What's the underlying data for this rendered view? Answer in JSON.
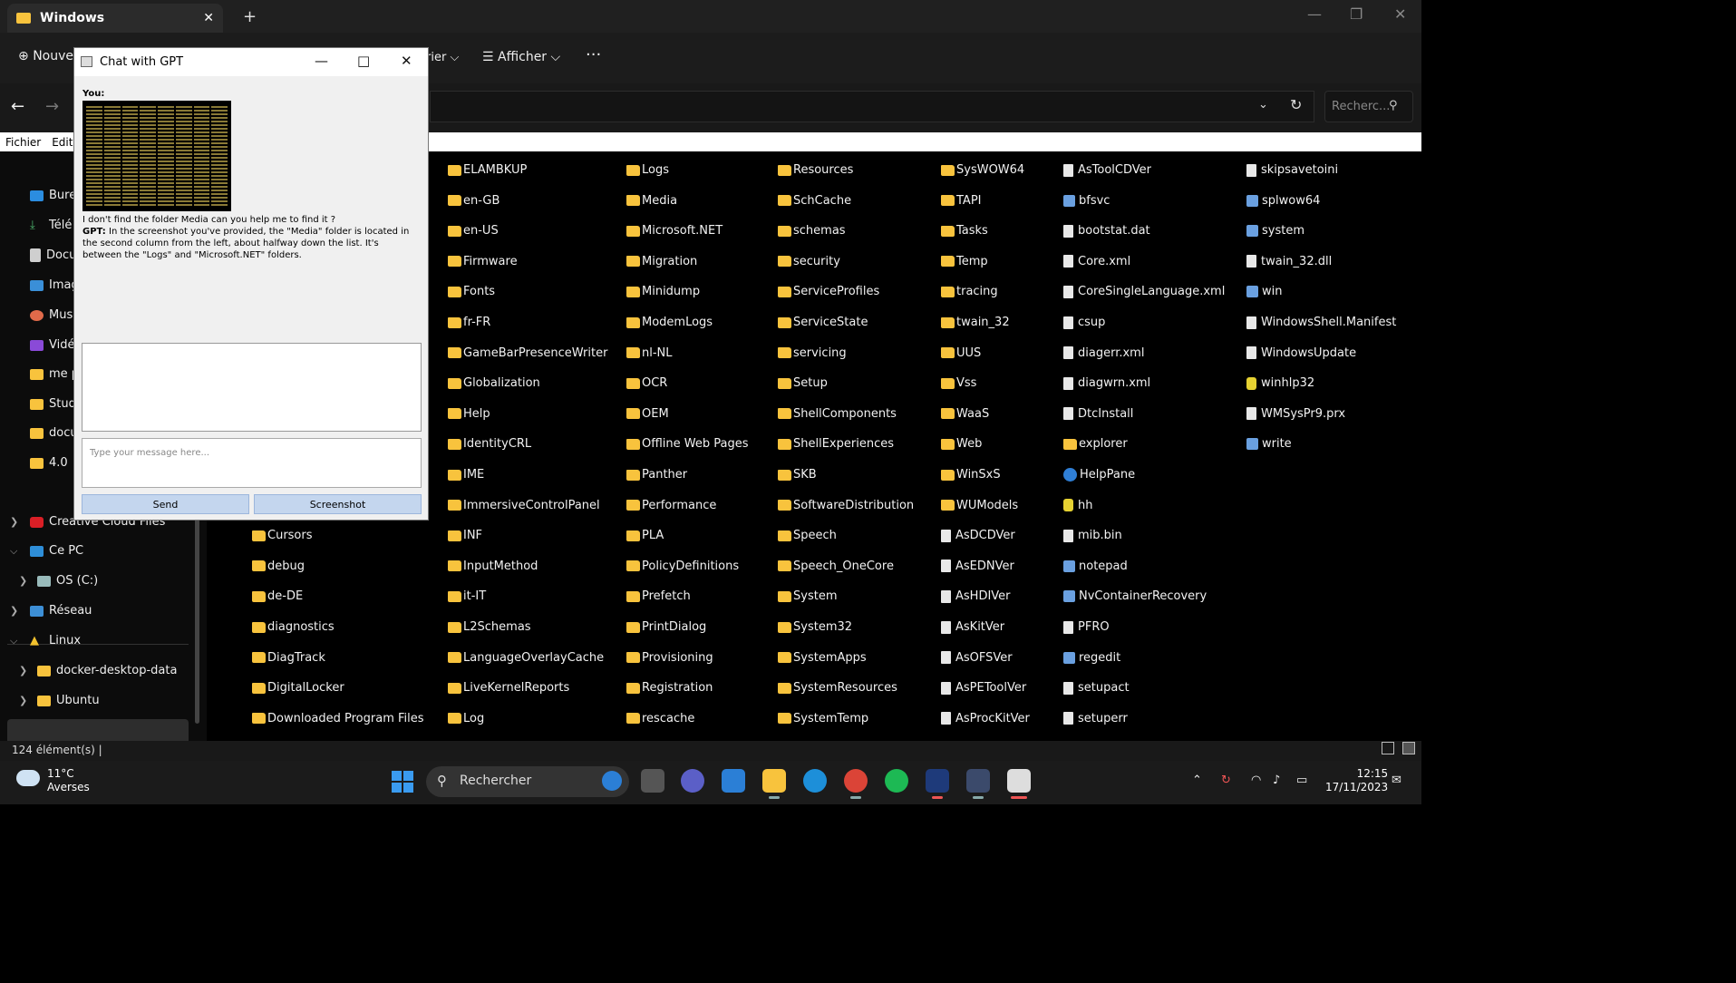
{
  "explorer": {
    "tab_title": "Windows",
    "close_tab": "✕",
    "new_tab": "+",
    "toolbar": {
      "new_label": "Nouve",
      "sort_label": "rier",
      "view_label": "Afficher",
      "more_label": "···"
    },
    "search_placeholder": "Recherc...",
    "menu": [
      "Fichier",
      "Editi"
    ],
    "status": "124 élément(s)   |",
    "sidebar": {
      "items": [
        "Bure",
        "Télé",
        "Docu",
        "Imag",
        "Musi",
        "Vidé",
        "me p",
        "Stud",
        "docu",
        "4.0"
      ],
      "creative_cloud": "Creative Cloud Files",
      "this_pc": "Ce PC",
      "os_c": "OS (C:)",
      "network": "Réseau",
      "linux": "Linux",
      "docker": "docker-desktop-data",
      "ubuntu": "Ubuntu"
    },
    "columns": [
      {
        "top_offset": 0,
        "items": [
          {
            "n": "Cursors",
            "t": "folder"
          },
          {
            "n": "debug",
            "t": "folder"
          },
          {
            "n": "de-DE",
            "t": "folder"
          },
          {
            "n": "diagnostics",
            "t": "folder"
          },
          {
            "n": "DiagTrack",
            "t": "folder"
          },
          {
            "n": "DigitalLocker",
            "t": "folder"
          },
          {
            "n": "Downloaded Program Files",
            "t": "folder"
          }
        ]
      },
      {
        "items": [
          {
            "n": "ELAMBKUP",
            "t": "folder"
          },
          {
            "n": "en-GB",
            "t": "folder"
          },
          {
            "n": "en-US",
            "t": "folder"
          },
          {
            "n": "Firmware",
            "t": "folder"
          },
          {
            "n": "Fonts",
            "t": "folder"
          },
          {
            "n": "fr-FR",
            "t": "folder"
          },
          {
            "n": "GameBarPresenceWriter",
            "t": "folder"
          },
          {
            "n": "Globalization",
            "t": "folder"
          },
          {
            "n": "Help",
            "t": "folder"
          },
          {
            "n": "IdentityCRL",
            "t": "folder"
          },
          {
            "n": "IME",
            "t": "folder"
          },
          {
            "n": "ImmersiveControlPanel",
            "t": "folder"
          },
          {
            "n": "INF",
            "t": "folder"
          },
          {
            "n": "InputMethod",
            "t": "folder"
          },
          {
            "n": "it-IT",
            "t": "folder"
          },
          {
            "n": "L2Schemas",
            "t": "folder"
          },
          {
            "n": "LanguageOverlayCache",
            "t": "folder"
          },
          {
            "n": "LiveKernelReports",
            "t": "folder"
          },
          {
            "n": "Log",
            "t": "folder"
          }
        ]
      },
      {
        "items": [
          {
            "n": "Logs",
            "t": "folder"
          },
          {
            "n": "Media",
            "t": "folder"
          },
          {
            "n": "Microsoft.NET",
            "t": "folder"
          },
          {
            "n": "Migration",
            "t": "folder"
          },
          {
            "n": "Minidump",
            "t": "folder"
          },
          {
            "n": "ModemLogs",
            "t": "folder"
          },
          {
            "n": "nl-NL",
            "t": "folder"
          },
          {
            "n": "OCR",
            "t": "folder"
          },
          {
            "n": "OEM",
            "t": "folder"
          },
          {
            "n": "Offline Web Pages",
            "t": "folder"
          },
          {
            "n": "Panther",
            "t": "folder"
          },
          {
            "n": "Performance",
            "t": "folder"
          },
          {
            "n": "PLA",
            "t": "folder"
          },
          {
            "n": "PolicyDefinitions",
            "t": "folder"
          },
          {
            "n": "Prefetch",
            "t": "folder"
          },
          {
            "n": "PrintDialog",
            "t": "folder"
          },
          {
            "n": "Provisioning",
            "t": "folder"
          },
          {
            "n": "Registration",
            "t": "folder"
          },
          {
            "n": "rescache",
            "t": "folder"
          }
        ]
      },
      {
        "items": [
          {
            "n": "Resources",
            "t": "folder"
          },
          {
            "n": "SchCache",
            "t": "folder"
          },
          {
            "n": "schemas",
            "t": "folder"
          },
          {
            "n": "security",
            "t": "folder"
          },
          {
            "n": "ServiceProfiles",
            "t": "folder"
          },
          {
            "n": "ServiceState",
            "t": "folder"
          },
          {
            "n": "servicing",
            "t": "folder"
          },
          {
            "n": "Setup",
            "t": "folder"
          },
          {
            "n": "ShellComponents",
            "t": "folder"
          },
          {
            "n": "ShellExperiences",
            "t": "folder"
          },
          {
            "n": "SKB",
            "t": "folder"
          },
          {
            "n": "SoftwareDistribution",
            "t": "folder"
          },
          {
            "n": "Speech",
            "t": "folder"
          },
          {
            "n": "Speech_OneCore",
            "t": "folder"
          },
          {
            "n": "System",
            "t": "folder"
          },
          {
            "n": "System32",
            "t": "folder"
          },
          {
            "n": "SystemApps",
            "t": "folder"
          },
          {
            "n": "SystemResources",
            "t": "folder"
          },
          {
            "n": "SystemTemp",
            "t": "folder"
          }
        ]
      },
      {
        "items": [
          {
            "n": "SysWOW64",
            "t": "folder"
          },
          {
            "n": "TAPI",
            "t": "folder"
          },
          {
            "n": "Tasks",
            "t": "folder"
          },
          {
            "n": "Temp",
            "t": "folder"
          },
          {
            "n": "tracing",
            "t": "folder"
          },
          {
            "n": "twain_32",
            "t": "folder"
          },
          {
            "n": "UUS",
            "t": "folder"
          },
          {
            "n": "Vss",
            "t": "folder"
          },
          {
            "n": "WaaS",
            "t": "folder"
          },
          {
            "n": "Web",
            "t": "folder"
          },
          {
            "n": "WinSxS",
            "t": "folder"
          },
          {
            "n": "WUModels",
            "t": "folder"
          },
          {
            "n": "AsDCDVer",
            "t": "file"
          },
          {
            "n": "AsEDNVer",
            "t": "file"
          },
          {
            "n": "AsHDIVer",
            "t": "file"
          },
          {
            "n": "AsKitVer",
            "t": "file"
          },
          {
            "n": "AsOFSVer",
            "t": "file"
          },
          {
            "n": "AsPEToolVer",
            "t": "file"
          },
          {
            "n": "AsProcKitVer",
            "t": "file"
          }
        ]
      },
      {
        "items": [
          {
            "n": "AsToolCDVer",
            "t": "file"
          },
          {
            "n": "bfsvc",
            "t": "app"
          },
          {
            "n": "bootstat.dat",
            "t": "file"
          },
          {
            "n": "Core.xml",
            "t": "file"
          },
          {
            "n": "CoreSingleLanguage.xml",
            "t": "file"
          },
          {
            "n": "csup",
            "t": "file"
          },
          {
            "n": "diagerr.xml",
            "t": "file"
          },
          {
            "n": "diagwrn.xml",
            "t": "file"
          },
          {
            "n": "DtcInstall",
            "t": "file"
          },
          {
            "n": "explorer",
            "t": "folder"
          },
          {
            "n": "HelpPane",
            "t": "help"
          },
          {
            "n": "hh",
            "t": "yq"
          },
          {
            "n": "mib.bin",
            "t": "file"
          },
          {
            "n": "notepad",
            "t": "app"
          },
          {
            "n": "NvContainerRecovery",
            "t": "app"
          },
          {
            "n": "PFRO",
            "t": "file"
          },
          {
            "n": "regedit",
            "t": "app"
          },
          {
            "n": "setupact",
            "t": "file"
          },
          {
            "n": "setuperr",
            "t": "file"
          }
        ]
      },
      {
        "items": [
          {
            "n": "skipsavetoini",
            "t": "file"
          },
          {
            "n": "splwow64",
            "t": "app"
          },
          {
            "n": "system",
            "t": "app"
          },
          {
            "n": "twain_32.dll",
            "t": "file"
          },
          {
            "n": "win",
            "t": "app"
          },
          {
            "n": "WindowsShell.Manifest",
            "t": "file"
          },
          {
            "n": "WindowsUpdate",
            "t": "file"
          },
          {
            "n": "winhlp32",
            "t": "yq"
          },
          {
            "n": "WMSysPr9.prx",
            "t": "file"
          },
          {
            "n": "write",
            "t": "app"
          }
        ]
      }
    ]
  },
  "chat": {
    "title": "Chat with GPT",
    "you_label": "You:",
    "user_message": "I don't find the folder Media can you help me to find it ?",
    "gpt_label": "GPT:",
    "gpt_message": "In the screenshot you've provided, the \"Media\" folder is located in the second column from the left, about halfway down the list. It's between the \"Logs\" and \"Microsoft.NET\" folders.",
    "input_placeholder": "Type your message here...",
    "send_label": "Send",
    "screenshot_label": "Screenshot"
  },
  "taskbar": {
    "temperature": "11°C",
    "weather": "Averses",
    "search": "Rechercher",
    "time": "12:15",
    "date": "17/11/2023"
  }
}
